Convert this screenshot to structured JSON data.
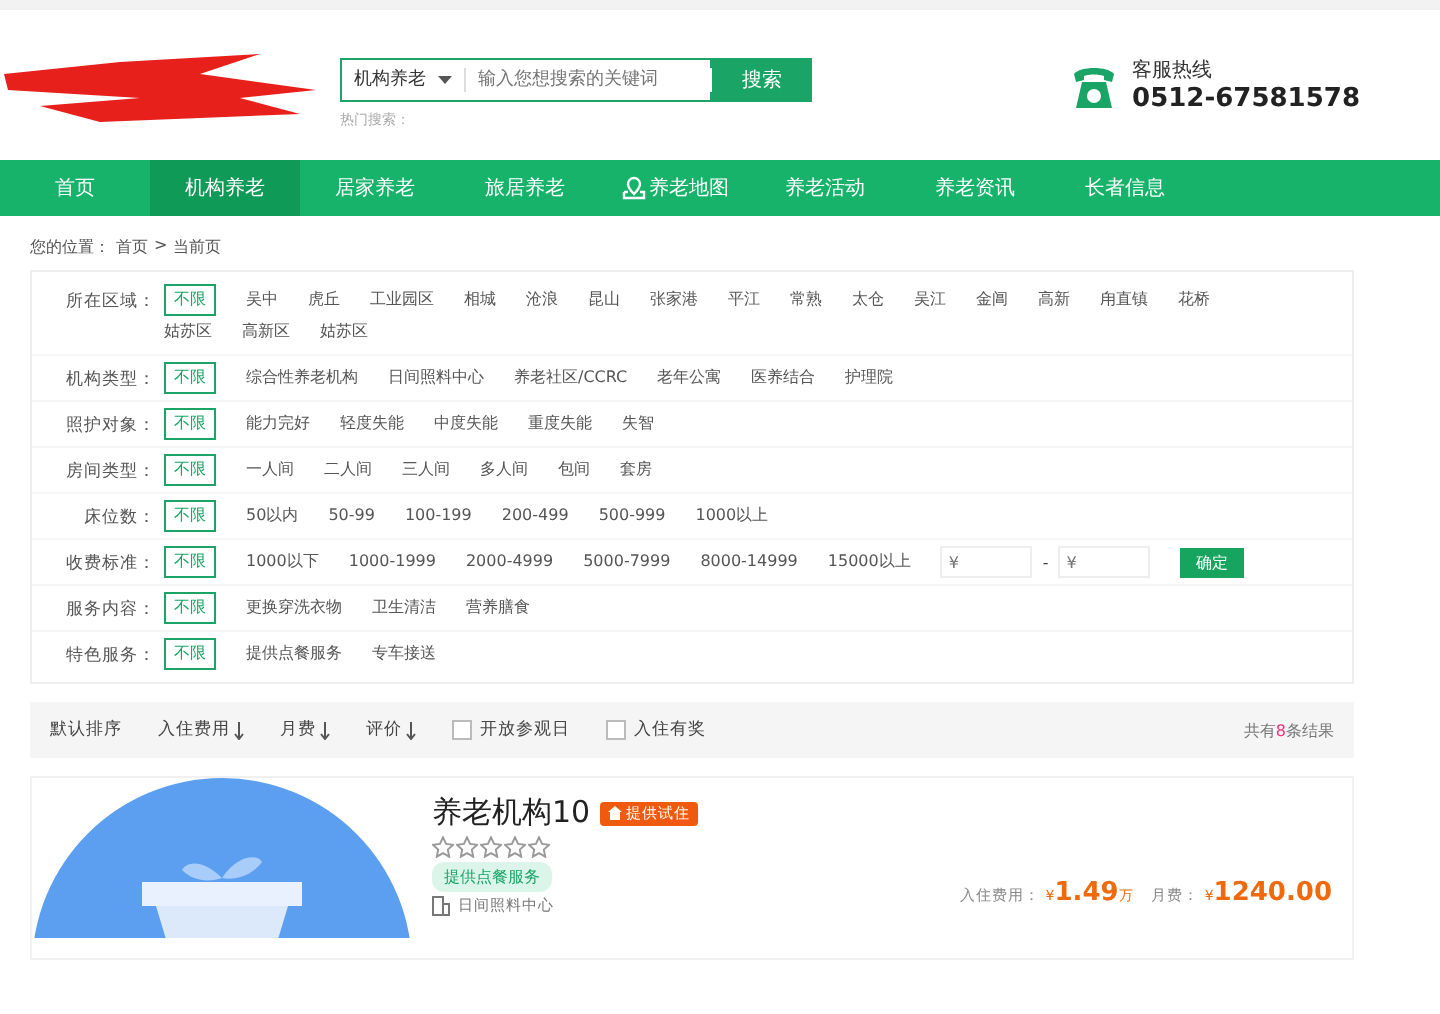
{
  "header": {
    "search": {
      "category": "机构养老",
      "placeholder": "输入您想搜索的关键词",
      "button": "搜索",
      "hot_label": "热门搜索："
    },
    "hotline": {
      "label": "客服热线",
      "number": "0512-67581578"
    }
  },
  "nav": [
    {
      "label": "首页",
      "selected": false,
      "icon": false
    },
    {
      "label": "机构养老",
      "selected": true,
      "icon": false
    },
    {
      "label": "居家养老",
      "selected": false,
      "icon": false
    },
    {
      "label": "旅居养老",
      "selected": false,
      "icon": false
    },
    {
      "label": "养老地图",
      "selected": false,
      "icon": true
    },
    {
      "label": "养老活动",
      "selected": false,
      "icon": false
    },
    {
      "label": "养老资讯",
      "selected": false,
      "icon": false
    },
    {
      "label": "长者信息",
      "selected": false,
      "icon": false
    }
  ],
  "breadcrumb": [
    "您的位置：",
    "首页",
    ">",
    "当前页"
  ],
  "filters": [
    {
      "label": "所在区域：",
      "options": [
        {
          "text": "不限",
          "selected": true
        },
        {
          "text": "吴中",
          "selected": false
        },
        {
          "text": "虎丘",
          "selected": false
        },
        {
          "text": "工业园区",
          "selected": false
        },
        {
          "text": "相城",
          "selected": false
        },
        {
          "text": "沧浪",
          "selected": false
        },
        {
          "text": "昆山",
          "selected": false
        },
        {
          "text": "张家港",
          "selected": false
        },
        {
          "text": "平江",
          "selected": false
        },
        {
          "text": "常熟",
          "selected": false
        },
        {
          "text": "太仓",
          "selected": false
        },
        {
          "text": "吴江",
          "selected": false
        },
        {
          "text": "金阊",
          "selected": false
        },
        {
          "text": "高新",
          "selected": false
        },
        {
          "text": "甪直镇",
          "selected": false
        },
        {
          "text": "花桥",
          "selected": false
        },
        {
          "text": "姑苏区",
          "selected": false
        },
        {
          "text": "高新区",
          "selected": false
        },
        {
          "text": "姑苏区",
          "selected": false
        }
      ]
    },
    {
      "label": "机构类型：",
      "options": [
        {
          "text": "不限",
          "selected": true
        },
        {
          "text": "综合性养老机构",
          "selected": false
        },
        {
          "text": "日间照料中心",
          "selected": false
        },
        {
          "text": "养老社区/CCRC",
          "selected": false
        },
        {
          "text": "老年公寓",
          "selected": false
        },
        {
          "text": "医养结合",
          "selected": false
        },
        {
          "text": "护理院",
          "selected": false
        }
      ]
    },
    {
      "label": "照护对象：",
      "options": [
        {
          "text": "不限",
          "selected": true
        },
        {
          "text": "能力完好",
          "selected": false
        },
        {
          "text": "轻度失能",
          "selected": false
        },
        {
          "text": "中度失能",
          "selected": false
        },
        {
          "text": "重度失能",
          "selected": false
        },
        {
          "text": "失智",
          "selected": false
        }
      ]
    },
    {
      "label": "房间类型：",
      "options": [
        {
          "text": "不限",
          "selected": true
        },
        {
          "text": "一人间",
          "selected": false
        },
        {
          "text": "二人间",
          "selected": false
        },
        {
          "text": "三人间",
          "selected": false
        },
        {
          "text": "多人间",
          "selected": false
        },
        {
          "text": "包间",
          "selected": false
        },
        {
          "text": "套房",
          "selected": false
        }
      ]
    },
    {
      "label": "床位数：",
      "options": [
        {
          "text": "不限",
          "selected": true
        },
        {
          "text": "50以内",
          "selected": false
        },
        {
          "text": "50-99",
          "selected": false
        },
        {
          "text": "100-199",
          "selected": false
        },
        {
          "text": "200-499",
          "selected": false
        },
        {
          "text": "500-999",
          "selected": false
        },
        {
          "text": "1000以上",
          "selected": false
        }
      ]
    },
    {
      "label": "收费标准：",
      "options": [
        {
          "text": "不限",
          "selected": true
        },
        {
          "text": "1000以下",
          "selected": false
        },
        {
          "text": "1000-1999",
          "selected": false
        },
        {
          "text": "2000-4999",
          "selected": false
        },
        {
          "text": "5000-7999",
          "selected": false
        },
        {
          "text": "8000-14999",
          "selected": false
        },
        {
          "text": "15000以上",
          "selected": false
        }
      ],
      "range": {
        "min_placeholder": "¥",
        "separator": "-",
        "max_placeholder": "¥",
        "button": "确定"
      }
    },
    {
      "label": "服务内容：",
      "options": [
        {
          "text": "不限",
          "selected": true
        },
        {
          "text": "更换穿洗衣物",
          "selected": false
        },
        {
          "text": "卫生清洁",
          "selected": false
        },
        {
          "text": "营养膳食",
          "selected": false
        }
      ]
    },
    {
      "label": "特色服务：",
      "options": [
        {
          "text": "不限",
          "selected": true
        },
        {
          "text": "提供点餐服务",
          "selected": false
        },
        {
          "text": "专车接送",
          "selected": false
        }
      ]
    }
  ],
  "sort_bar": {
    "sorts": [
      {
        "label": "默认排序",
        "arrow": false
      },
      {
        "label": "入住费用",
        "arrow": true
      },
      {
        "label": "月费",
        "arrow": true
      },
      {
        "label": "评价",
        "arrow": true
      }
    ],
    "checkboxes": [
      {
        "label": "开放参观日",
        "checked": false
      },
      {
        "label": "入住有奖",
        "checked": false
      }
    ],
    "result": {
      "prefix": "共有",
      "count": "8",
      "suffix": "条结果"
    }
  },
  "listing": {
    "title": "养老机构10",
    "badge": "提供试住",
    "stars": 0,
    "tag": "提供点餐服务",
    "type": "日间照料中心",
    "fee_label": "入住费用：",
    "fee_currency": "¥",
    "fee_value": "1.49",
    "fee_unit": "万",
    "monthly_label": "月费：",
    "monthly_currency": "¥",
    "monthly_value": "1240.00"
  }
}
